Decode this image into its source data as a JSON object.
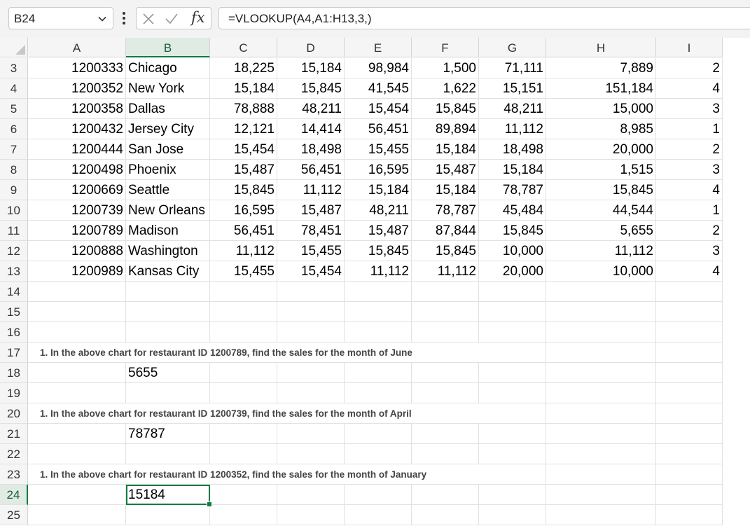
{
  "formula_bar": {
    "name_box": "B24",
    "fx_label": "fx",
    "formula": "=VLOOKUP(A4,A1:H13,3,)"
  },
  "columns": [
    "A",
    "B",
    "C",
    "D",
    "E",
    "F",
    "G",
    "H",
    "I"
  ],
  "selected_column": "B",
  "rows": [
    {
      "n": "3",
      "cells": [
        "1200333",
        "Chicago",
        "18,225",
        "15,184",
        "98,984",
        "1,500",
        "71,111",
        "7,889",
        "2"
      ]
    },
    {
      "n": "4",
      "cells": [
        "1200352",
        "New York",
        "15,184",
        "15,845",
        "41,545",
        "1,622",
        "15,151",
        "151,184",
        "4"
      ]
    },
    {
      "n": "5",
      "cells": [
        "1200358",
        "Dallas",
        "78,888",
        "48,211",
        "15,454",
        "15,845",
        "48,211",
        "15,000",
        "3"
      ]
    },
    {
      "n": "6",
      "cells": [
        "1200432",
        "Jersey City",
        "12,121",
        "14,414",
        "56,451",
        "89,894",
        "11,112",
        "8,985",
        "1"
      ]
    },
    {
      "n": "7",
      "cells": [
        "1200444",
        "San Jose",
        "15,454",
        "18,498",
        "15,455",
        "15,184",
        "18,498",
        "20,000",
        "2"
      ]
    },
    {
      "n": "8",
      "cells": [
        "1200498",
        "Phoenix",
        "15,487",
        "56,451",
        "16,595",
        "15,487",
        "15,184",
        "1,515",
        "3"
      ]
    },
    {
      "n": "9",
      "cells": [
        "1200669",
        "Seattle",
        "15,845",
        "11,112",
        "15,184",
        "15,184",
        "78,787",
        "15,845",
        "4"
      ]
    },
    {
      "n": "10",
      "cells": [
        "1200739",
        "New Orleans",
        "16,595",
        "15,487",
        "48,211",
        "78,787",
        "45,484",
        "44,544",
        "1"
      ]
    },
    {
      "n": "11",
      "cells": [
        "1200789",
        "Madison",
        "56,451",
        "78,451",
        "15,487",
        "87,844",
        "15,845",
        "5,655",
        "2"
      ]
    },
    {
      "n": "12",
      "cells": [
        "1200888",
        "Washington",
        "11,112",
        "15,455",
        "15,845",
        "15,845",
        "10,000",
        "11,112",
        "3"
      ]
    },
    {
      "n": "13",
      "cells": [
        "1200989",
        "Kansas City",
        "15,455",
        "15,454",
        "11,112",
        "11,112",
        "20,000",
        "10,000",
        "4"
      ]
    },
    {
      "n": "14",
      "cells": []
    },
    {
      "n": "15",
      "cells": []
    },
    {
      "n": "16",
      "cells": []
    },
    {
      "n": "17",
      "note": "1. In the above chart for restaurant ID 1200789, find the sales for the month of June"
    },
    {
      "n": "18",
      "cells": [
        "",
        "5655"
      ]
    },
    {
      "n": "19",
      "cells": []
    },
    {
      "n": "20",
      "note": "1. In the above chart for restaurant ID 1200739, find the sales for the month of April"
    },
    {
      "n": "21",
      "cells": [
        "",
        "78787"
      ]
    },
    {
      "n": "22",
      "cells": []
    },
    {
      "n": "23",
      "note": "1. In the above chart for restaurant ID 1200352, find the sales for the month of January"
    },
    {
      "n": "24",
      "cells": [
        "",
        "15184"
      ],
      "active_col": 1
    },
    {
      "n": "25",
      "cells": []
    }
  ],
  "colors": {
    "accent": "#107c41",
    "header_bg": "#f5f5f5",
    "selected_header_bg": "#e0ebe3"
  }
}
